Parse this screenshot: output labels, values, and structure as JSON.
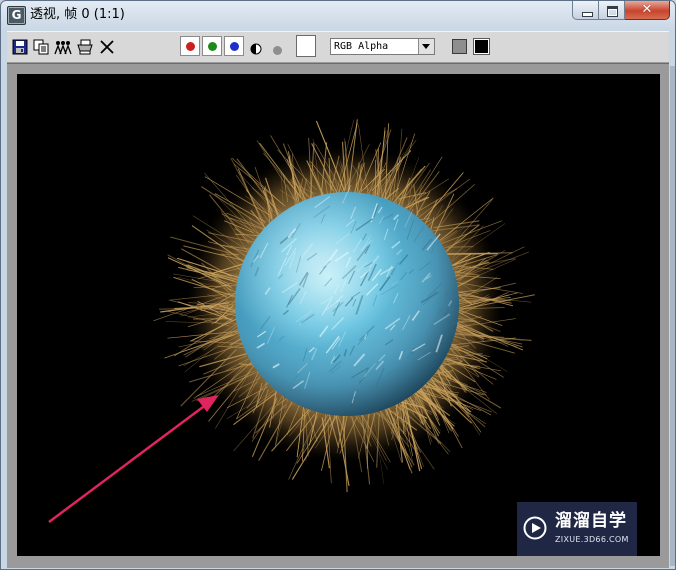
{
  "window": {
    "title": "透视, 帧 0 (1:1)",
    "app_icon_letter": "G",
    "controls": {
      "minimize_icon": "minimize-icon",
      "maximize_icon": "maximize-icon",
      "close_icon": "close-icon",
      "close_glyph": "✕"
    }
  },
  "toolbar": {
    "icons": [
      "save-icon",
      "copy-icon",
      "clone-window-icon",
      "print-icon",
      "clear-icon"
    ],
    "color_channels": [
      {
        "name": "red-channel",
        "color": "#cc1f1f"
      },
      {
        "name": "green-channel",
        "color": "#1d8a1d"
      },
      {
        "name": "blue-channel",
        "color": "#1f2fcc"
      }
    ],
    "alpha_icon": "half-circle-icon",
    "mono_icon": "mono-dot-icon",
    "swatch_color": "#ffffff",
    "channel_value": "RGB Alpha",
    "gray_button_color": "#8e8e8e",
    "black_button_color": "#000000"
  },
  "render": {
    "background": "#000000",
    "sphere_color": "#5fb6d6",
    "fur_color": "#c9a15c",
    "arrow_color": "#e0245e"
  },
  "watermark": {
    "title": "溜溜自学",
    "subtitle": "ZIXUE.3D66.COM"
  }
}
